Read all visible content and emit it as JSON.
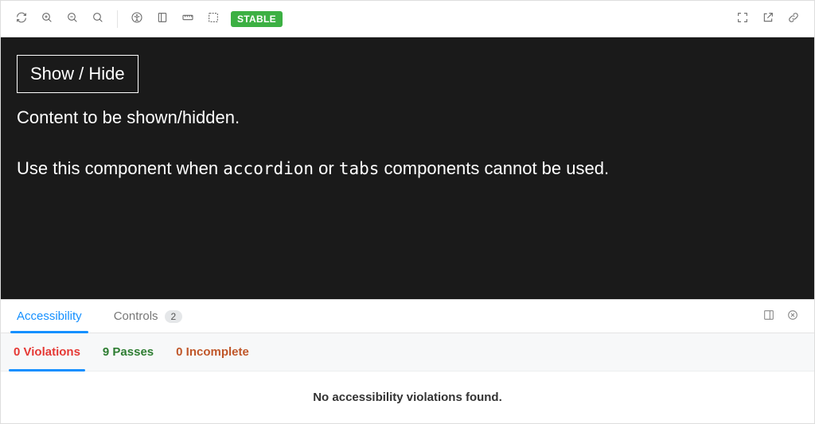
{
  "toolbar": {
    "remount_title": "Remount component",
    "zoom_in_title": "Zoom in",
    "zoom_out_title": "Zoom out",
    "zoom_reset_title": "Reset zoom",
    "a11y_title": "Accessibility",
    "grid_title": "Change preview size",
    "measure_title": "Enable measure",
    "outline_title": "Apply outlines",
    "badge": "STABLE",
    "fullscreen_title": "Go full screen",
    "open_title": "Open in new tab",
    "link_title": "Copy link"
  },
  "canvas": {
    "button_label": "Show / Hide",
    "content_text": "Content to be shown/hidden.",
    "hint_prefix": "Use this component when ",
    "code1": "accordion",
    "mid": " or ",
    "code2": "tabs",
    "hint_suffix": " components cannot be used."
  },
  "addons": {
    "tabs": [
      {
        "label": "Accessibility",
        "count": null,
        "active": true
      },
      {
        "label": "Controls",
        "count": "2",
        "active": false
      }
    ],
    "side_title": "Change orientation",
    "hide_title": "Hide addons"
  },
  "a11y": {
    "tabs": [
      {
        "label": "0 Violations",
        "cls": "c-red",
        "active": true
      },
      {
        "label": "9 Passes",
        "cls": "c-green",
        "active": false
      },
      {
        "label": "0 Incomplete",
        "cls": "c-orange",
        "active": false
      }
    ],
    "empty_message": "No accessibility violations found."
  }
}
